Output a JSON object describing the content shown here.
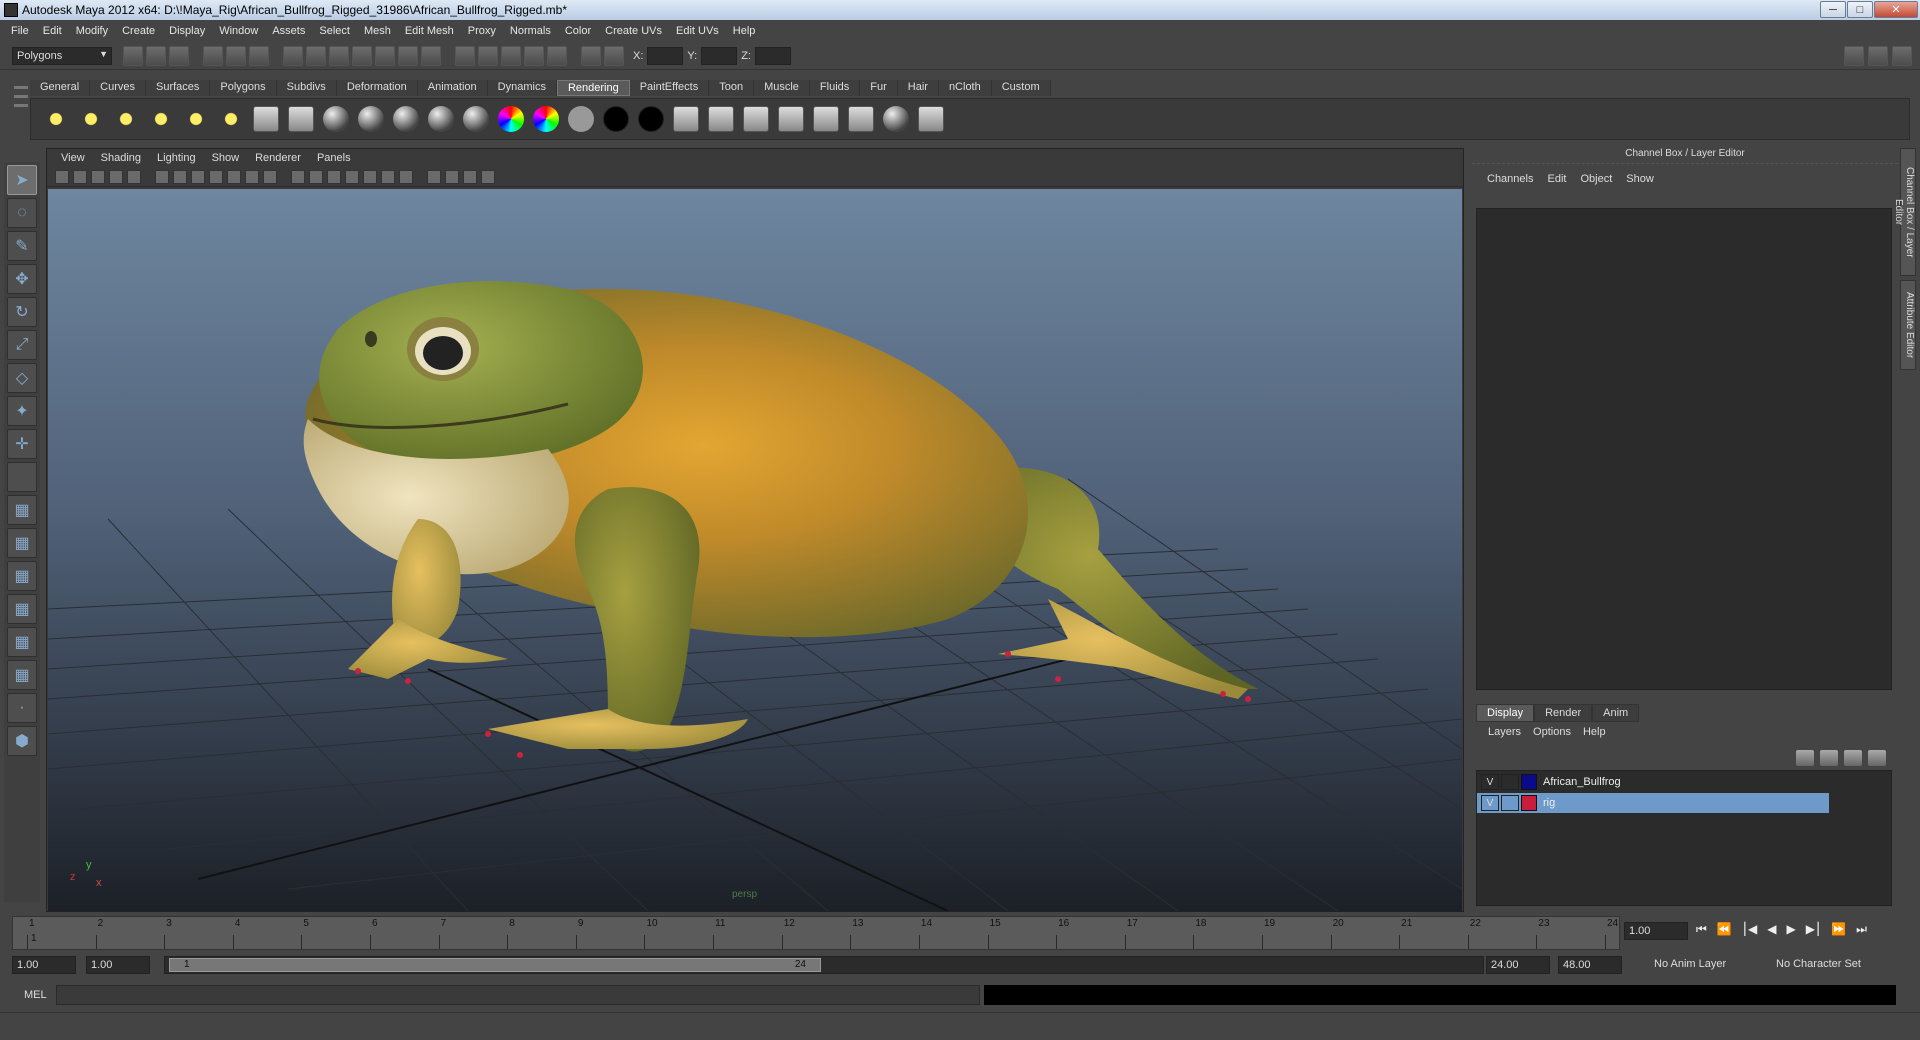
{
  "window": {
    "title": "Autodesk Maya 2012 x64: D:\\!Maya_Rig\\African_Bullfrog_Rigged_31986\\African_Bullfrog_Rigged.mb*",
    "minimize": "─",
    "maximize": "□",
    "close": "✕"
  },
  "menubar": [
    "File",
    "Edit",
    "Modify",
    "Create",
    "Display",
    "Window",
    "Assets",
    "Select",
    "Mesh",
    "Edit Mesh",
    "Proxy",
    "Normals",
    "Color",
    "Create UVs",
    "Edit UVs",
    "Help"
  ],
  "statusline": {
    "mode": "Polygons",
    "x_label": "X:",
    "y_label": "Y:",
    "z_label": "Z:"
  },
  "shelf": {
    "tabs": [
      "General",
      "Curves",
      "Surfaces",
      "Polygons",
      "Subdivs",
      "Deformation",
      "Animation",
      "Dynamics",
      "Rendering",
      "PaintEffects",
      "Toon",
      "Muscle",
      "Fluids",
      "Fur",
      "Hair",
      "nCloth",
      "Custom"
    ],
    "active_tab": "Rendering"
  },
  "viewport": {
    "menu": [
      "View",
      "Shading",
      "Lighting",
      "Show",
      "Renderer",
      "Panels"
    ],
    "camera": "persp",
    "axis_x": "x",
    "axis_y": "y",
    "axis_z": "z"
  },
  "channel_box": {
    "title": "Channel Box / Layer Editor",
    "menu": [
      "Channels",
      "Edit",
      "Object",
      "Show"
    ],
    "side_tabs": [
      "Channel Box / Layer Editor",
      "Attribute Editor"
    ]
  },
  "layers": {
    "tabs": [
      "Display",
      "Render",
      "Anim"
    ],
    "active_tab": "Display",
    "menu": [
      "Layers",
      "Options",
      "Help"
    ],
    "items": [
      {
        "v": "V",
        "name": "African_Bullfrog",
        "color": "#0a0a8a"
      },
      {
        "v": "V",
        "name": "rig",
        "color": "#c81e3c"
      }
    ]
  },
  "timeline": {
    "frames": [
      "1",
      "2",
      "3",
      "4",
      "5",
      "6",
      "7",
      "8",
      "9",
      "10",
      "11",
      "12",
      "13",
      "14",
      "15",
      "16",
      "17",
      "18",
      "19",
      "20",
      "21",
      "22",
      "23",
      "24"
    ],
    "current_frame": "1",
    "current_time": "1.00"
  },
  "range": {
    "start": "1.00",
    "playback_start": "1.00",
    "slider_start": "1",
    "slider_end": "24",
    "playback_end": "24.00",
    "end": "48.00",
    "anim_layer": "No Anim Layer",
    "character_set": "No Character Set"
  },
  "command_line": {
    "label": "MEL"
  }
}
